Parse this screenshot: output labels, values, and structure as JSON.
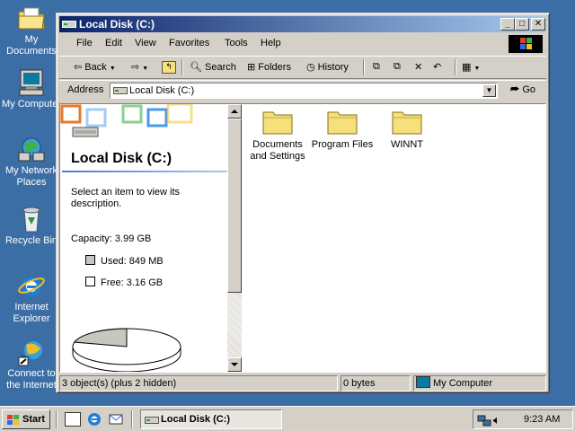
{
  "desktop": {
    "icons": [
      {
        "label": "My Documents",
        "icon": "my-documents-folder-icon"
      },
      {
        "label": "My Computer",
        "icon": "my-computer-icon"
      },
      {
        "label": "My Network\nPlaces",
        "icon": "network-places-icon"
      },
      {
        "label": "Recycle Bin",
        "icon": "recycle-bin-icon"
      },
      {
        "label": "Internet\nExplorer",
        "icon": "internet-explorer-icon"
      },
      {
        "label": "Connect to\nthe Internet",
        "icon": "connect-internet-icon"
      }
    ],
    "background_color": "#3a6ea5"
  },
  "window": {
    "title": "Local Disk (C:)",
    "controls": {
      "minimize": "_",
      "maximize": "□",
      "close": "✕"
    },
    "menu": [
      "File",
      "Edit",
      "View",
      "Favorites",
      "Tools",
      "Help"
    ],
    "toolbar": {
      "back": "Back",
      "search": "Search",
      "folders": "Folders",
      "history": "History"
    },
    "address": {
      "label": "Address",
      "value": "Local Disk (C:)",
      "go": "Go"
    },
    "left_pane": {
      "title": "Local Disk (C:)",
      "description": "Select an item to view its description.",
      "capacity": "Capacity: 3.99 GB",
      "used": "Used: 849 MB",
      "free": "Free: 3.16 GB",
      "used_fraction": 0.21
    },
    "items": [
      {
        "label": "Documents\nand Settings",
        "icon": "folder-icon"
      },
      {
        "label": "Program Files",
        "icon": "folder-icon"
      },
      {
        "label": "WINNT",
        "icon": "folder-icon"
      }
    ],
    "status": {
      "objects": "3 object(s) (plus 2 hidden)",
      "size": "0 bytes",
      "zone": "My Computer"
    }
  },
  "taskbar": {
    "start": "Start",
    "task": "Local Disk (C:)",
    "clock": "9:23 AM"
  },
  "colors": {
    "titlebar_start": "#0a246a",
    "titlebar_end": "#a6caf0",
    "chrome": "#d4d0c8",
    "folder": "#f5e07a"
  }
}
